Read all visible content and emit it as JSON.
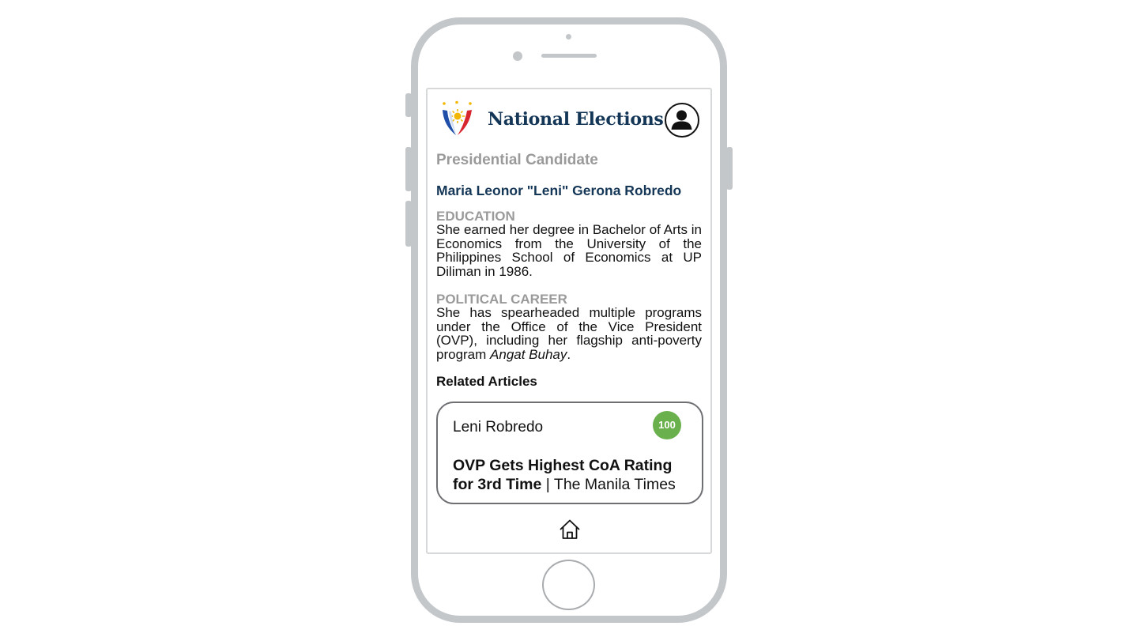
{
  "app": {
    "title": "National Elections"
  },
  "page": {
    "section_title": "Presidential Candidate",
    "candidate_name": "Maria Leonor \"Leni\" Gerona Robredo",
    "education": {
      "label": "EDUCATION",
      "text": "She earned her degree in Bachelor of Arts in Economics from the University of the Philippines School of Economics at UP Diliman in 1986."
    },
    "political_career": {
      "label": "POLITICAL CAREER",
      "text_before": "She has spearheaded multiple programs under the Office of the Vice President (OVP), including her flagship anti-poverty program ",
      "text_italic": "Angat Buhay",
      "text_after": "."
    },
    "related_title": "Related Articles"
  },
  "article": {
    "candidate": "Leni Robredo",
    "score": "100",
    "headline": "OVP Gets Highest CoA Rating for 3rd Time",
    "separator": " | ",
    "source": "The Manila Times"
  },
  "icons": {
    "logo": "philippine-sun-logo-icon",
    "profile": "user-profile-icon",
    "home": "home-icon"
  },
  "colors": {
    "title_navy": "#143657",
    "muted_gray": "#9a9a9a",
    "badge_green": "#6ab04c",
    "frame_gray": "#c4c7ca"
  }
}
